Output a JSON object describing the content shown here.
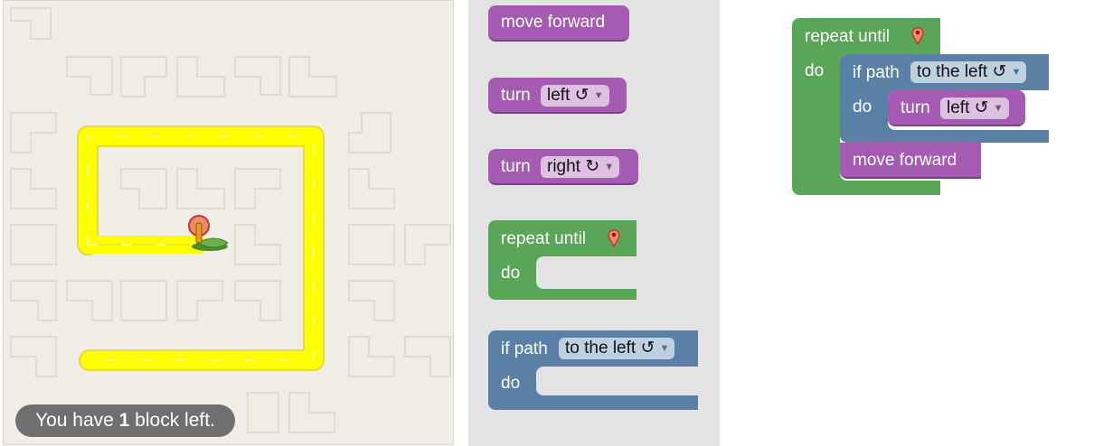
{
  "maze": {
    "message_prefix": "You have ",
    "message_count": "1",
    "message_suffix": " block left."
  },
  "toolbox": {
    "move_forward": "move forward",
    "turn_left": {
      "label": "turn",
      "dropdown": "left ↺"
    },
    "turn_right": {
      "label": "turn",
      "dropdown": "right ↻"
    },
    "repeat_until": {
      "label": "repeat until",
      "do": "do"
    },
    "if_path": {
      "label": "if path",
      "dropdown": "to the left ↺",
      "do": "do"
    }
  },
  "workspace": {
    "repeat_until": {
      "label": "repeat until",
      "do": "do"
    },
    "if_path": {
      "label": "if path",
      "dropdown": "to the left ↺",
      "do": "do"
    },
    "turn": {
      "label": "turn",
      "dropdown": "left ↺"
    },
    "move_forward": "move forward"
  },
  "icons": {
    "goal": "map-pin-icon",
    "player": "pegman-icon",
    "dropdown": "triangle-down-icon"
  },
  "colors": {
    "path": "#ffff00",
    "motion_block": "#a55bb1",
    "loop_block": "#59a659",
    "logic_block": "#5b80a5",
    "maze_bg": "#f1eee7",
    "toolbox_bg": "#e3e3e3"
  }
}
